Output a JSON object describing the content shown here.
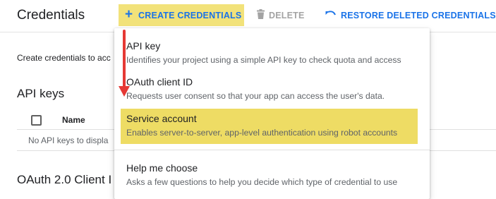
{
  "header": {
    "title": "Credentials",
    "create_label": "CREATE CREDENTIALS",
    "delete_label": "DELETE",
    "restore_label": "RESTORE DELETED CREDENTIALS"
  },
  "content": {
    "intro": "Create credentials to acc",
    "api_keys_title": "API keys",
    "name_column": "Name",
    "empty_text": "No API keys to displa",
    "oauth_title": "OAuth 2.0 Client I"
  },
  "menu": {
    "items": [
      {
        "title": "API key",
        "description": "Identifies your project using a simple API key to check quota and access"
      },
      {
        "title": "OAuth client ID",
        "description": "Requests user consent so that your app can access the user's data."
      },
      {
        "title": "Service account",
        "description": "Enables server-to-server, app-level authentication using robot accounts",
        "highlighted": true
      },
      {
        "title": "Help me choose",
        "description": "Asks a few questions to help you decide which type of credential to use"
      }
    ]
  },
  "colors": {
    "accent": "#1a73e8",
    "highlight": "#eedc64",
    "annotation_arrow": "#e53935"
  }
}
